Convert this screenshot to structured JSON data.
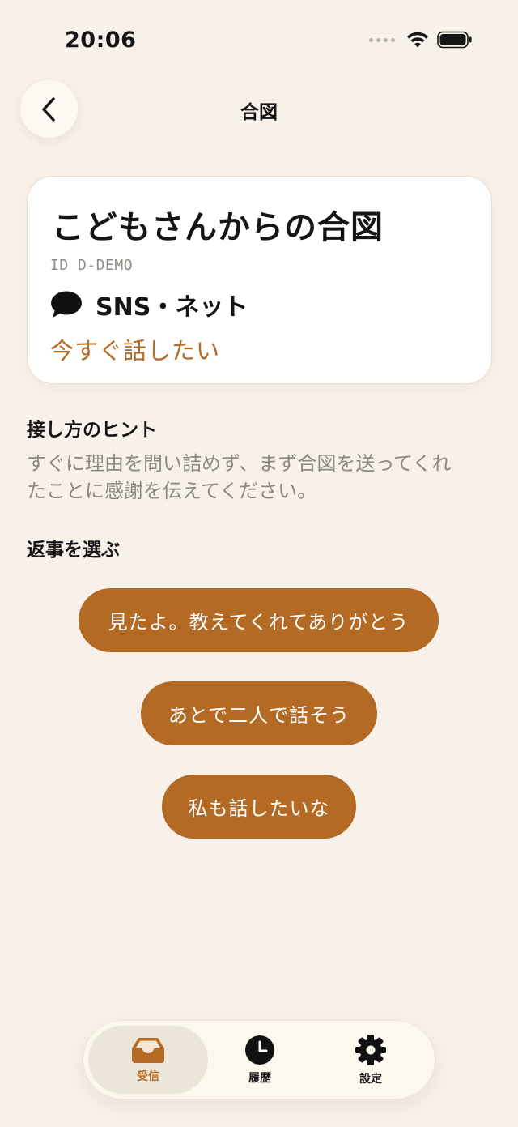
{
  "status_bar": {
    "time": "20:06"
  },
  "nav": {
    "title": "合図"
  },
  "card": {
    "title": "こどもさんからの合図",
    "id_text": "ID D-DEMO",
    "category": "SNS・ネット",
    "urgency": "今すぐ話したい"
  },
  "hint": {
    "heading": "接し方のヒント",
    "body": "すぐに理由を問い詰めず、まず合図を送ってくれたことに感謝を伝えてください。"
  },
  "replies": {
    "heading": "返事を選ぶ",
    "options": [
      "見たよ。教えてくれてありがとう",
      "あとで二人で話そう",
      "私も話したいな"
    ]
  },
  "tab_bar": {
    "tabs": [
      {
        "label": "受信",
        "icon": "inbox-icon",
        "active": true
      },
      {
        "label": "履歴",
        "icon": "clock-icon",
        "active": false
      },
      {
        "label": "設定",
        "icon": "gear-icon",
        "active": false
      }
    ]
  },
  "colors": {
    "background": "#f8f1ea",
    "accent": "#b26a25",
    "card": "#ffffff",
    "muted_text": "#8d8883"
  }
}
